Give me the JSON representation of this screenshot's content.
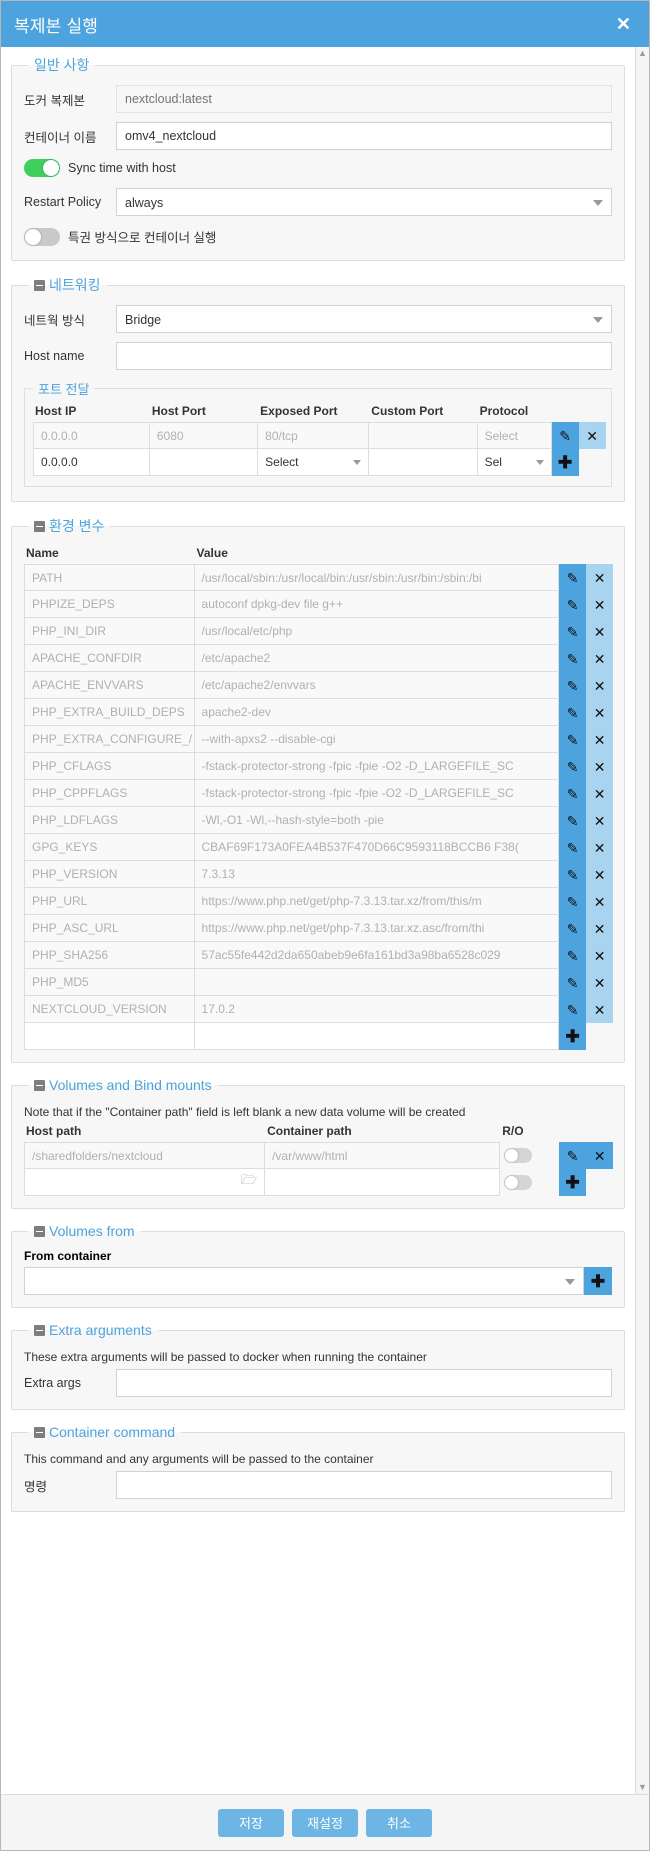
{
  "window": {
    "title": "복제본 실행",
    "close_icon": "close-icon"
  },
  "general": {
    "legend": "일반 사항",
    "image_label": "도커 복제본",
    "image_placeholder": "nextcloud:latest",
    "name_label": "컨테이너 이름",
    "name_value": "omv4_nextcloud",
    "sync_time_label": "Sync time with host",
    "sync_time_on": true,
    "restart_label": "Restart Policy",
    "restart_value": "always",
    "privileged_label": "특권 방식으로 컨테이너 실행",
    "privileged_on": false
  },
  "networking": {
    "legend": "네트워킹",
    "mode_label": "네트웍 방식",
    "mode_value": "Bridge",
    "hostname_label": "Host name",
    "hostname_value": "",
    "ports": {
      "legend": "포트 전달",
      "headers": [
        "Host IP",
        "Host Port",
        "Exposed Port",
        "Custom Port",
        "Protocol"
      ],
      "rows": [
        {
          "host_ip": "0.0.0.0",
          "host_port": "6080",
          "exposed_port": "80/tcp",
          "custom_port": "",
          "protocol": "Select",
          "editable": false,
          "actions": [
            "edit-icon",
            "delete-icon"
          ]
        },
        {
          "host_ip": "0.0.0.0",
          "host_port": "",
          "exposed_port": "Select",
          "custom_port": "",
          "protocol": "Sel",
          "editable": true,
          "actions": [
            "add-icon"
          ]
        }
      ]
    }
  },
  "env": {
    "legend": "환경 변수",
    "headers": [
      "Name",
      "Value"
    ],
    "rows": [
      {
        "name": "PATH",
        "value": "/usr/local/sbin:/usr/local/bin:/usr/sbin:/usr/bin:/sbin:/bi"
      },
      {
        "name": "PHPIZE_DEPS",
        "value": "autoconf\t\tdpkg-dev\t\tfile\t\tg++"
      },
      {
        "name": "PHP_INI_DIR",
        "value": "/usr/local/etc/php"
      },
      {
        "name": "APACHE_CONFDIR",
        "value": "/etc/apache2"
      },
      {
        "name": "APACHE_ENVVARS",
        "value": "/etc/apache2/envvars"
      },
      {
        "name": "PHP_EXTRA_BUILD_DEPS",
        "value": "apache2-dev"
      },
      {
        "name": "PHP_EXTRA_CONFIGURE_/",
        "value": "--with-apxs2 --disable-cgi"
      },
      {
        "name": "PHP_CFLAGS",
        "value": "-fstack-protector-strong -fpic -fpie -O2 -D_LARGEFILE_SC"
      },
      {
        "name": "PHP_CPPFLAGS",
        "value": "-fstack-protector-strong -fpic -fpie -O2 -D_LARGEFILE_SC"
      },
      {
        "name": "PHP_LDFLAGS",
        "value": "-Wl,-O1 -Wl,--hash-style=both -pie"
      },
      {
        "name": "GPG_KEYS",
        "value": "CBAF69F173A0FEA4B537F470D66C9593118BCCB6 F38("
      },
      {
        "name": "PHP_VERSION",
        "value": "7.3.13"
      },
      {
        "name": "PHP_URL",
        "value": "https://www.php.net/get/php-7.3.13.tar.xz/from/this/m"
      },
      {
        "name": "PHP_ASC_URL",
        "value": "https://www.php.net/get/php-7.3.13.tar.xz.asc/from/thi"
      },
      {
        "name": "PHP_SHA256",
        "value": "57ac55fe442d2da650abeb9e6fa161bd3a98ba6528c029"
      },
      {
        "name": "PHP_MD5",
        "value": ""
      },
      {
        "name": "NEXTCLOUD_VERSION",
        "value": "17.0.2"
      }
    ],
    "new_row": {
      "name": "",
      "value": ""
    },
    "edit_icon": "edit-icon",
    "delete_icon": "delete-icon",
    "add_icon": "add-icon"
  },
  "volumes": {
    "legend": "Volumes and Bind mounts",
    "note": "Note that if the \"Container path\" field is left blank a new data volume will be created",
    "headers": [
      "Host path",
      "Container path",
      "R/O"
    ],
    "rows": [
      {
        "host_path": "/sharedfolders/nextcloud",
        "container_path": "/var/www/html",
        "ro": false,
        "editable": false,
        "actions": [
          "edit-icon",
          "delete-icon"
        ]
      },
      {
        "host_path": "",
        "container_path": "",
        "ro": false,
        "editable": true,
        "browse_icon": "folder-icon",
        "actions": [
          "add-icon"
        ]
      }
    ]
  },
  "volumes_from": {
    "legend": "Volumes from",
    "label": "From container",
    "value": "",
    "add_icon": "add-icon"
  },
  "extra_args": {
    "legend": "Extra arguments",
    "note": "These extra arguments will be passed to docker when running the container",
    "label": "Extra args",
    "value": ""
  },
  "container_command": {
    "legend": "Container command",
    "note": "This command and any arguments will be passed to the container",
    "label": "명령",
    "value": ""
  },
  "footer": {
    "save": "저장",
    "reset": "재설정",
    "cancel": "취소"
  },
  "colors": {
    "accent": "#4da3dd",
    "titlebar": "#4da3dd",
    "toggle_on": "#3ecf5c",
    "button": "#6cb5e4"
  }
}
